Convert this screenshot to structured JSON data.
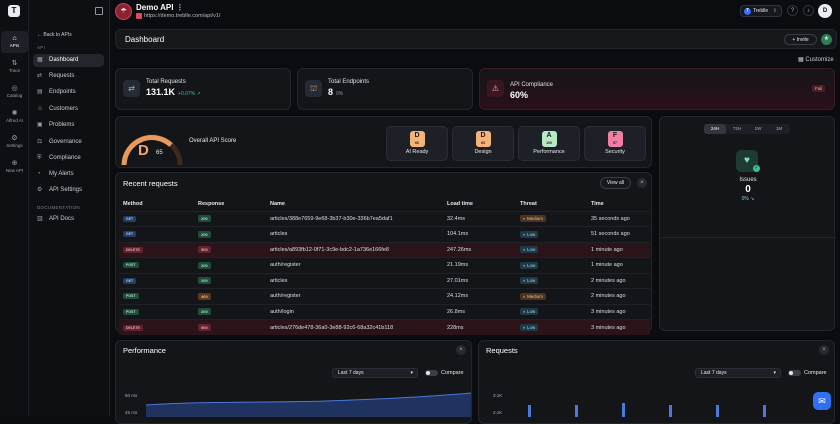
{
  "rail": {
    "items": [
      {
        "label": "APIs",
        "icon": "⌂"
      },
      {
        "label": "Trace",
        "icon": "⇅"
      },
      {
        "label": "Catalog",
        "icon": "◎"
      },
      {
        "label": "Alfred AI",
        "icon": "✺"
      },
      {
        "label": "Settings",
        "icon": "⚙"
      },
      {
        "label": "New API",
        "icon": "⊕"
      }
    ]
  },
  "subnav": {
    "back": "← Back to APIs",
    "api_group": "API",
    "documentation_group": "DOCUMENTATION",
    "items": [
      {
        "label": "Dashboard",
        "icon": "▦"
      },
      {
        "label": "Requests",
        "icon": "⇄"
      },
      {
        "label": "Endpoints",
        "icon": "▤"
      },
      {
        "label": "Customers",
        "icon": "☺"
      },
      {
        "label": "Problems",
        "icon": "▣"
      },
      {
        "label": "Governance",
        "icon": "⚖"
      },
      {
        "label": "Compliance",
        "icon": "⛨"
      },
      {
        "label": "My Alerts",
        "icon": "◔"
      },
      {
        "label": "API Settings",
        "icon": "⚙"
      }
    ],
    "docs_item": {
      "label": "API Docs",
      "icon": "▥"
    }
  },
  "topbar": {
    "api_name": "Demo API",
    "api_url": "https://demo.treblle.com/api/v1/",
    "org": "Treblle",
    "user_initial": "D"
  },
  "header": {
    "title": "Dashboard",
    "invite": "+ Invite",
    "customize": "Customize"
  },
  "stats": [
    {
      "label": "Total Requests",
      "value": "131.1K",
      "delta": "+0.07% ↗"
    },
    {
      "label": "Total Endpoints",
      "value": "8",
      "delta": "0%"
    }
  ],
  "compliance": {
    "label": "API Compliance",
    "value": "60%",
    "status": "Fail"
  },
  "score": {
    "grade": "D",
    "value": "65",
    "label": "Overall API Score"
  },
  "grades": [
    {
      "letter": "D",
      "score": "60",
      "label": "AI Ready",
      "color": "#f5b27a"
    },
    {
      "letter": "D",
      "score": "63",
      "label": "Design",
      "color": "#f5b27a"
    },
    {
      "letter": "A",
      "score": "100",
      "label": "Performance",
      "color": "#b9e8c5"
    },
    {
      "letter": "F",
      "score": "57",
      "label": "Security",
      "color": "#f27fa2"
    }
  ],
  "issues": {
    "ranges": [
      "24H",
      "72H",
      "1W",
      "1M"
    ],
    "label": "Issues",
    "count": "0",
    "delta": "0% ↘"
  },
  "requests": {
    "title": "Recent requests",
    "view_all": "View all",
    "columns": [
      "Method",
      "Response",
      "Name",
      "Load time",
      "Threat",
      "Time"
    ],
    "rows": [
      {
        "method": "GET",
        "response": "200",
        "name": "articles/388e7659-9e68-3b37-b30e-336b7ea5daf1",
        "load": "32.4ms",
        "threat": "Medium",
        "time": "35 seconds ago"
      },
      {
        "method": "GET",
        "response": "200",
        "name": "articles",
        "load": "104.1ms",
        "threat": "Low",
        "time": "51 seconds ago"
      },
      {
        "method": "DELETE",
        "response": "500",
        "name": "articles/a893fb12-0f71-3c9e-bdc2-1a736e166fe8",
        "load": "247.26ms",
        "threat": "Low",
        "time": "1 minute ago"
      },
      {
        "method": "POST",
        "response": "200",
        "name": "auth/register",
        "load": "21.19ms",
        "threat": "Low",
        "time": "1 minute ago"
      },
      {
        "method": "GET",
        "response": "200",
        "name": "articles",
        "load": "27.01ms",
        "threat": "Low",
        "time": "2 minutes ago"
      },
      {
        "method": "POST",
        "response": "400",
        "name": "auth/register",
        "load": "24.12ms",
        "threat": "Medium",
        "time": "2 minutes ago"
      },
      {
        "method": "POST",
        "response": "200",
        "name": "auth/login",
        "load": "26.8ms",
        "threat": "Low",
        "time": "3 minutes ago"
      },
      {
        "method": "DELETE",
        "response": "500",
        "name": "articles/276de478-36a0-3e88-92c6-68a32c41b118",
        "load": "228ms",
        "threat": "Low",
        "time": "3 minutes ago"
      }
    ]
  },
  "performance": {
    "title": "Performance",
    "range": "Last 7 days",
    "compare": "Compare",
    "ticks": [
      "60 ms",
      "45 ms"
    ]
  },
  "requests_chart": {
    "title": "Requests",
    "range": "Last 7 days",
    "compare": "Compare",
    "ticks": [
      "3.1K",
      "2.1K"
    ]
  }
}
